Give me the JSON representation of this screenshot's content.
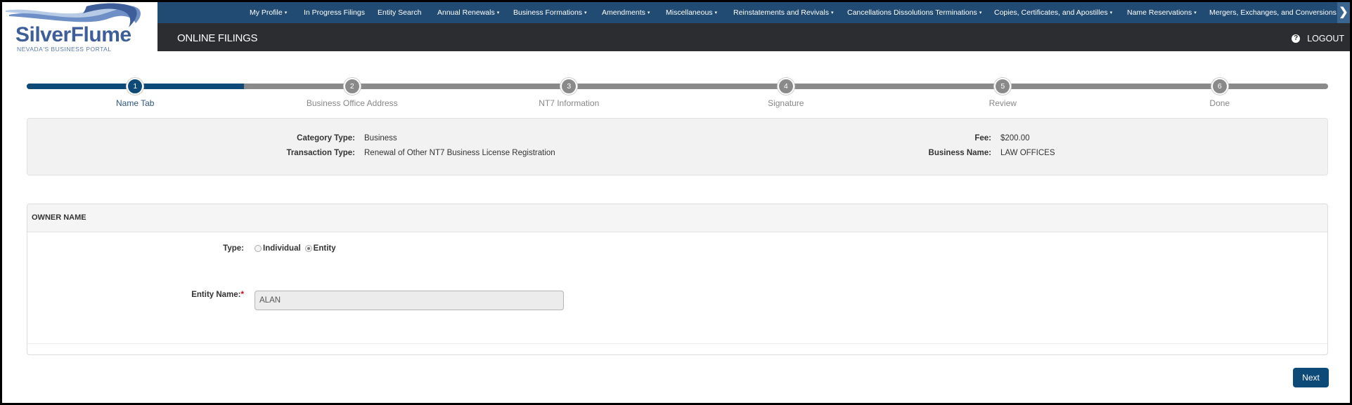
{
  "logo": {
    "title": "SilverFlume",
    "subtitle": "NEVADA'S BUSINESS PORTAL"
  },
  "nav": {
    "items": [
      {
        "label": "My Profile",
        "dropdown": true
      },
      {
        "label": "In Progress Filings",
        "dropdown": false
      },
      {
        "label": "Entity Search",
        "dropdown": false
      },
      {
        "label": "Annual Renewals",
        "dropdown": true
      },
      {
        "label": "Business Formations",
        "dropdown": true
      },
      {
        "label": "Amendments",
        "dropdown": true
      },
      {
        "label": "Miscellaneous",
        "dropdown": true
      },
      {
        "label": "Reinstatements and Revivals",
        "dropdown": true
      },
      {
        "label": "Cancellations Dissolutions Terminations",
        "dropdown": true
      },
      {
        "label": "Copies, Certificates, and Apostilles",
        "dropdown": true
      },
      {
        "label": "Name Reservations",
        "dropdown": true
      },
      {
        "label": "Mergers, Exchanges, and Conversions",
        "dropdown": true
      }
    ],
    "caret_glyph": "▾",
    "next_glyph": "❯"
  },
  "header": {
    "title": "ONLINE FILINGS",
    "logout_label": "LOGOUT",
    "help_glyph": "?"
  },
  "stepper": {
    "current_step": 1,
    "progress_fraction": 0.1667,
    "steps": [
      {
        "number": "1",
        "label": "Name Tab"
      },
      {
        "number": "2",
        "label": "Business Office Address"
      },
      {
        "number": "3",
        "label": "NT7 Information"
      },
      {
        "number": "4",
        "label": "Signature"
      },
      {
        "number": "5",
        "label": "Review"
      },
      {
        "number": "6",
        "label": "Done"
      }
    ]
  },
  "info": {
    "category_type_label": "Category Type:",
    "category_type_value": "Business",
    "transaction_type_label": "Transaction Type:",
    "transaction_type_value": "Renewal of Other NT7 Business License Registration",
    "fee_label": "Fee:",
    "fee_value": "$200.00",
    "business_name_label": "Business Name:",
    "business_name_value": "LAW OFFICES"
  },
  "owner": {
    "heading": "OWNER NAME",
    "type_label": "Type:",
    "type_options": [
      {
        "label": "Individual",
        "checked": false
      },
      {
        "label": "Entity",
        "checked": true
      }
    ],
    "entity_name_label": "Entity Name:",
    "required_mark": "*",
    "entity_name_value": "ALAN"
  },
  "actions": {
    "next_label": "Next"
  },
  "colors": {
    "nav_bg": "#214b73",
    "header_bg": "#2b2d31",
    "accent": "#0d4a78",
    "step_inactive": "#8a8a8a"
  }
}
